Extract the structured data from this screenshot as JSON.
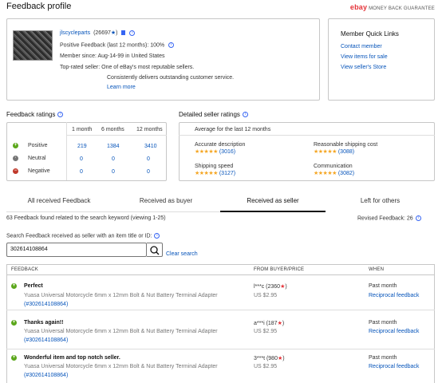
{
  "page": {
    "title": "Feedback profile"
  },
  "mbg": {
    "brand": "ebay",
    "label": "MONEY BACK GUARANTEE"
  },
  "seller": {
    "username": "jlscycleparts",
    "score": "(26697",
    "positive_feedback": "Positive Feedback (last 12 months): 100%",
    "member_since": "Member since: Aug-14-99 in United States",
    "top_rated": "Top-rated seller: One of eBay's most reputable sellers.",
    "top_rated_detail": "Consistently delivers outstanding customer service.",
    "learn_more": "Learn more"
  },
  "quick_links": {
    "title": "Member Quick Links",
    "items": [
      "Contact member",
      "View items for sale",
      "View seller's Store"
    ]
  },
  "feedback_ratings": {
    "title": "Feedback ratings",
    "columns": [
      "1 month",
      "6 months",
      "12 months"
    ],
    "rows": [
      {
        "label": "Positive",
        "values": [
          "219",
          "1384",
          "3410"
        ]
      },
      {
        "label": "Neutral",
        "values": [
          "0",
          "0",
          "0"
        ]
      },
      {
        "label": "Negative",
        "values": [
          "0",
          "0",
          "0"
        ]
      }
    ]
  },
  "detailed_ratings": {
    "title": "Detailed seller ratings",
    "subtitle": "Average for the last 12 months",
    "items": [
      {
        "label": "Accurate description",
        "count": "(3016)",
        "stars": 5
      },
      {
        "label": "Reasonable shipping cost",
        "count": "(3088)",
        "stars": 5
      },
      {
        "label": "Shipping speed",
        "count": "(3127)",
        "stars": 5
      },
      {
        "label": "Communication",
        "count": "(3082)",
        "stars": 5
      }
    ]
  },
  "tabs": [
    {
      "label": "All received Feedback",
      "active": false
    },
    {
      "label": "Received as buyer",
      "active": false
    },
    {
      "label": "Received as seller",
      "active": true
    },
    {
      "label": "Left for others",
      "active": false
    }
  ],
  "results": {
    "found_text": "63 Feedback found related to the search keyword (viewing 1-25)",
    "revised": "Revised Feedback: 26"
  },
  "search": {
    "label": "Search Feedback received as seller with an item title or ID:",
    "value": "302614108864",
    "clear": "Clear search"
  },
  "table": {
    "headers": [
      "FEEDBACK",
      "FROM BUYER/PRICE",
      "WHEN"
    ],
    "rows": [
      {
        "comment": "Perfect",
        "item": "Yuasa Universal Motorcycle 6mm x 12mm Bolt & Nut Battery Terminal Adapter",
        "item_id": "(#302614108864)",
        "buyer": "l***c (2360",
        "price": "US $2.95",
        "when": "Past month",
        "action": "Reciprocal feedback"
      },
      {
        "comment": "Thanks again!!",
        "item": "Yuasa Universal Motorcycle 6mm x 12mm Bolt & Nut Battery Terminal Adapter",
        "item_id": "(#302614108864)",
        "buyer": "a***i (187",
        "price": "US $2.95",
        "when": "Past month",
        "action": "Reciprocal feedback"
      },
      {
        "comment": "Wonderful item and top notch seller.",
        "item": "Yuasa Universal Motorcycle 6mm x 12mm Bolt & Nut Battery Terminal Adapter",
        "item_id": "(#302614108864)",
        "buyer": "3***t (980",
        "price": "US $2.95",
        "when": "Past month",
        "action": "Reciprocal feedback"
      }
    ]
  }
}
